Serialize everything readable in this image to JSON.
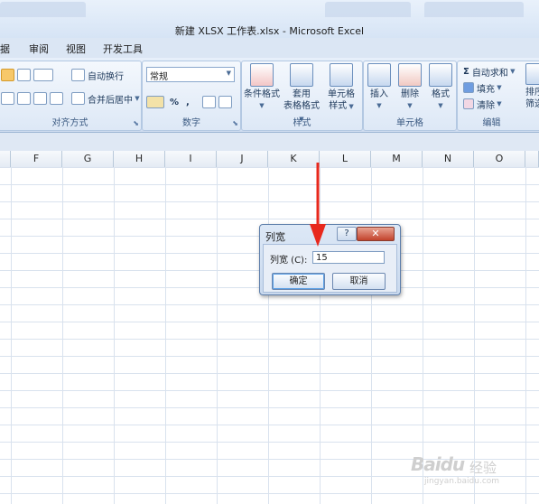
{
  "window": {
    "title": "新建 XLSX 工作表.xlsx - Microsoft Excel"
  },
  "menu_tabs": [
    "据",
    "审阅",
    "视图",
    "开发工具"
  ],
  "ribbon": {
    "alignment": {
      "wrap_text": "自动换行",
      "merge_center": "合并后居中",
      "group_label": "对齐方式"
    },
    "number": {
      "format_value": "常规",
      "percent": "%",
      "comma": ",",
      "inc_decimal": "←.0\n.00",
      "dec_decimal": ".00\n→.0",
      "group_label": "数字"
    },
    "styles": {
      "conditional_format": "条件格式",
      "table_format_1": "套用",
      "table_format_2": "表格格式",
      "cell_styles_1": "单元格",
      "cell_styles_2": "样式",
      "group_label": "样式"
    },
    "cells": {
      "insert": "插入",
      "delete": "删除",
      "format": "格式",
      "group_label": "单元格"
    },
    "editing": {
      "autosum": "自动求和",
      "fill": "填充",
      "clear": "清除",
      "sort_1": "排序",
      "sort_2": "筛选",
      "group_label": "编辑"
    }
  },
  "columns": [
    "F",
    "G",
    "H",
    "I",
    "J",
    "K",
    "L",
    "M",
    "N",
    "O"
  ],
  "dialog": {
    "title": "列宽",
    "help": "?",
    "close": "✕",
    "label": "列宽 (C):",
    "value": "15",
    "ok": "确定",
    "cancel": "取消"
  },
  "watermark": {
    "brand": "Baidu",
    "brand_cn": "经验",
    "sub": "jingyan.baidu.com"
  },
  "colors": {
    "arrow": "#e8281c",
    "ribbon_text": "#1e395b"
  }
}
